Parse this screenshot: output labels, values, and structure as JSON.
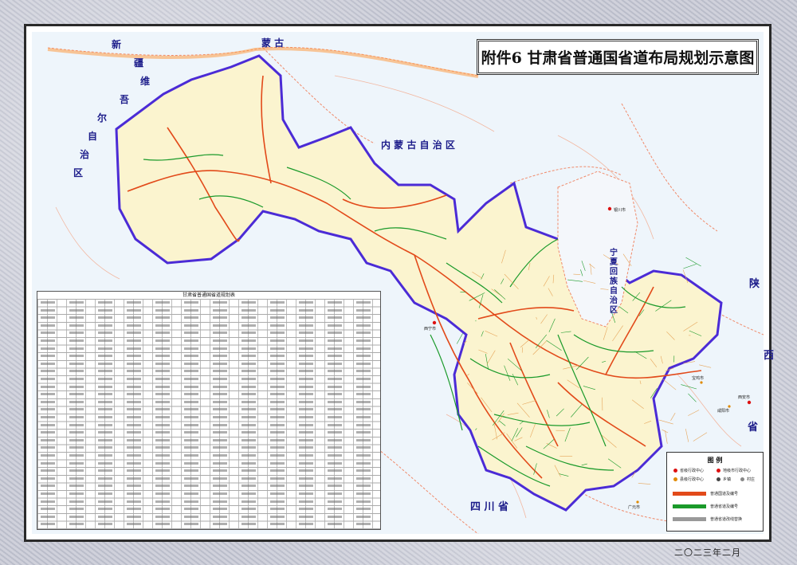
{
  "title": "附件6 甘肃省普通国省道布局规划示意图",
  "date": "二〇二三年二月",
  "regions": {
    "mongolia": "蒙  古",
    "xinjiang": [
      "新",
      "疆",
      "维",
      "吾",
      "尔",
      "自",
      "治",
      "区"
    ],
    "inner_mongolia": "内 蒙 古 自 治 区",
    "ningxia": [
      "宁",
      "夏",
      "回",
      "族",
      "自",
      "治",
      "区"
    ],
    "shaanxi": [
      "陕",
      "西",
      "省"
    ],
    "sichuan": "四  川  省"
  },
  "cities": [
    "西宁市",
    "银川市",
    "西安市",
    "咸阳市",
    "宝鸡市",
    "广元市"
  ],
  "table": {
    "title": "甘肃省普通国省道规划表"
  },
  "legend": {
    "title": "图  例",
    "items": [
      {
        "label": "省级行政中心",
        "color": "#d11"
      },
      {
        "label": "地级市行政中心",
        "color": "#d11"
      },
      {
        "label": "县级行政中心",
        "color": "#e08a00"
      },
      {
        "label": "乡镇",
        "color": "#444"
      },
      {
        "label": "村庄",
        "color": "#888"
      }
    ],
    "lines": [
      {
        "label": "普通国道及编号",
        "color": "#e24a1a"
      },
      {
        "label": "普通省道及编号",
        "color": "#1a9a2a"
      },
      {
        "label": "普通省道改线替换",
        "color": "#999999"
      }
    ]
  },
  "colors": {
    "gansu_fill": "#fbf4cf",
    "border": "#4b2bd6",
    "national_road": "#e24a1a",
    "provincial_road": "#1a9a2a",
    "water": "#e9f3fb"
  }
}
